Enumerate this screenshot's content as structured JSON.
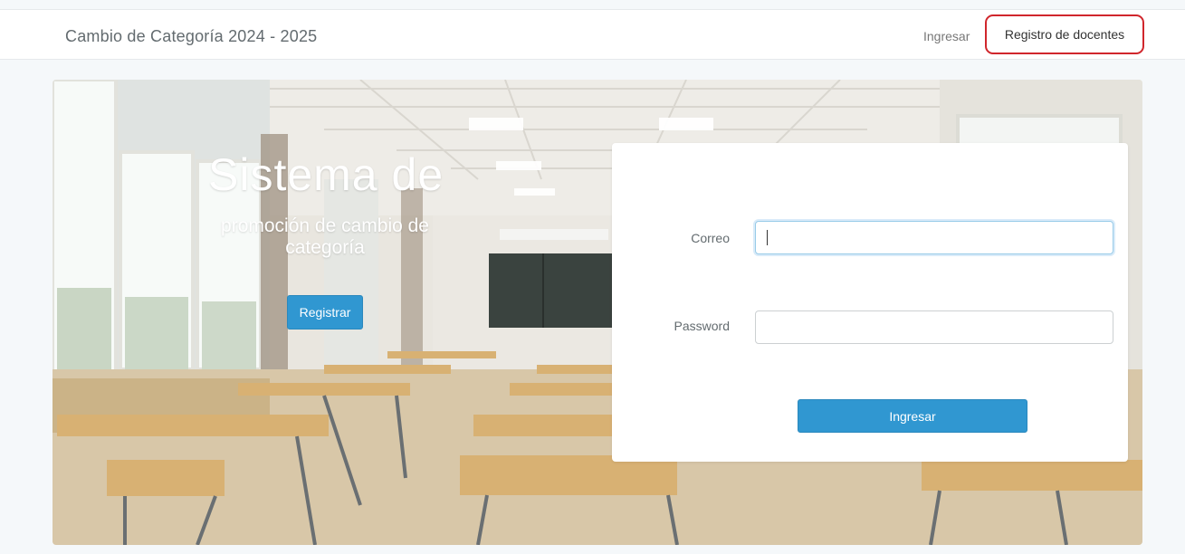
{
  "navbar": {
    "brand": "Cambio de Categoría 2024 - 2025",
    "links": [
      {
        "label": "Ingresar"
      },
      {
        "label": "Registro de docentes"
      }
    ]
  },
  "hero": {
    "title": "Sistema de",
    "subtitle": "promoción de cambio de categoría",
    "register_button": "Registrar"
  },
  "login": {
    "email_label": "Correo",
    "email_value": "",
    "password_label": "Password",
    "password_value": "",
    "submit_label": "Ingresar"
  },
  "colors": {
    "primary": "#3097d1",
    "highlight_border": "#d0262c",
    "background": "#f5f8fa"
  }
}
